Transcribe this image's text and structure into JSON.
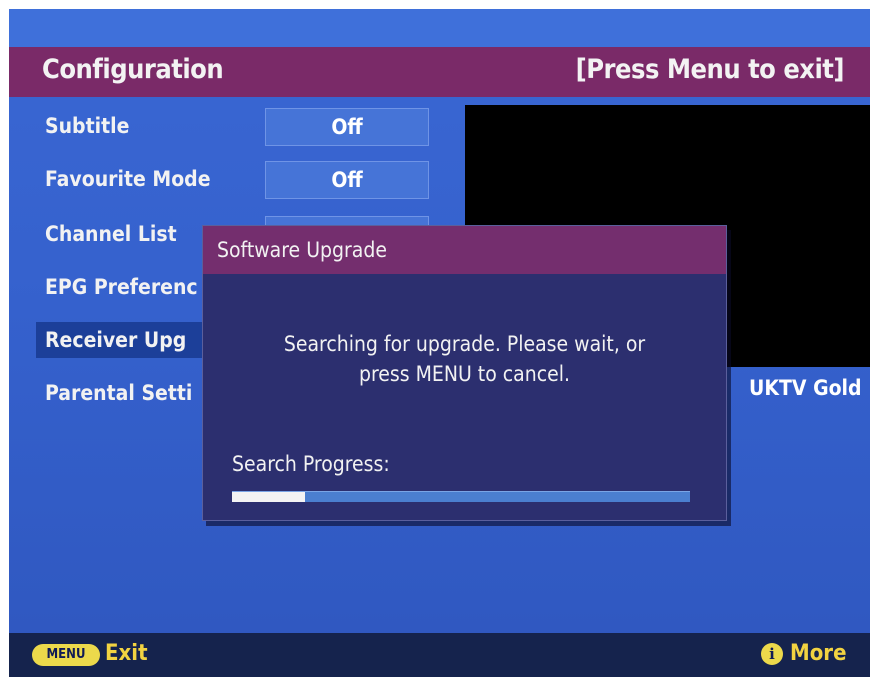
{
  "header": {
    "title": "Configuration",
    "exit_hint": "[Press Menu to exit]"
  },
  "menu": {
    "items": [
      {
        "label": "Subtitle",
        "value": "Off"
      },
      {
        "label": "Favourite Mode",
        "value": "Off"
      },
      {
        "label": "Channel List",
        "value": ""
      },
      {
        "label": "EPG Preferenc",
        "value": ""
      },
      {
        "label": "Receiver Upg",
        "value": "",
        "selected": true
      },
      {
        "label": "Parental Setti",
        "value": ""
      }
    ]
  },
  "preview": {
    "channel_name": "UKTV Gold"
  },
  "dialog": {
    "title": "Software Upgrade",
    "message_line1": "Searching for upgrade. Please wait, or",
    "message_line2": "press MENU to cancel.",
    "progress_label": "Search Progress:",
    "progress_fraction": 0.16
  },
  "footer": {
    "menu_button_label": "MENU",
    "exit_label": "Exit",
    "info_icon": "i",
    "more_label": "More"
  },
  "colors": {
    "title_bar": "#7a2a68",
    "background": "#3561cd",
    "dialog_body": "#2c2f6f",
    "accent_yellow": "#ecd94b"
  }
}
